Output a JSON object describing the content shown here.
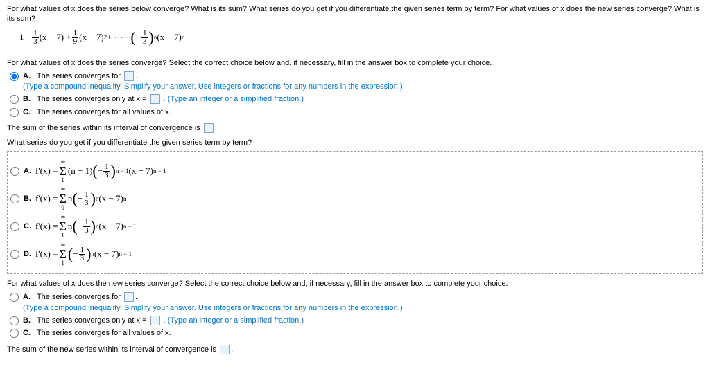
{
  "q_intro": "For what values of x does the series below converge? What is its sum? What series do you get if you differentiate the given series term by term? For what values of x does the new series converge? What is its sum?",
  "subq1": "For what values of x does the series converge? Select the correct choice below and, if necessary, fill in the answer box to complete your choice.",
  "choice_a_text": "The series converges for ",
  "choice_a_hint": "(Type a compound inequality. Simplify your answer. Use integers or fractions for any numbers in the expression.)",
  "choice_b_text": "The series converges only at x = ",
  "choice_b_hint": ". (Type an integer or a simplified fraction.)",
  "choice_c_text": "The series converges for all values of x.",
  "sum_stmt": "The sum of the series within its interval of convergence is ",
  "diff_q": "What series do you get if you differentiate the given series term by term?",
  "label_A": "A.",
  "label_B": "B.",
  "label_C": "C.",
  "label_D": "D.",
  "fprime_eq": "f'(x) = ",
  "subq3": "For what values of x does the new series converge? Select the correct choice below and, if necessary, fill in the answer box to complete your choice.",
  "sum_stmt2": "The sum of the new series within its interval of convergence is ",
  "period": ".",
  "inf": "∞",
  "one": "1",
  "zero": "0"
}
